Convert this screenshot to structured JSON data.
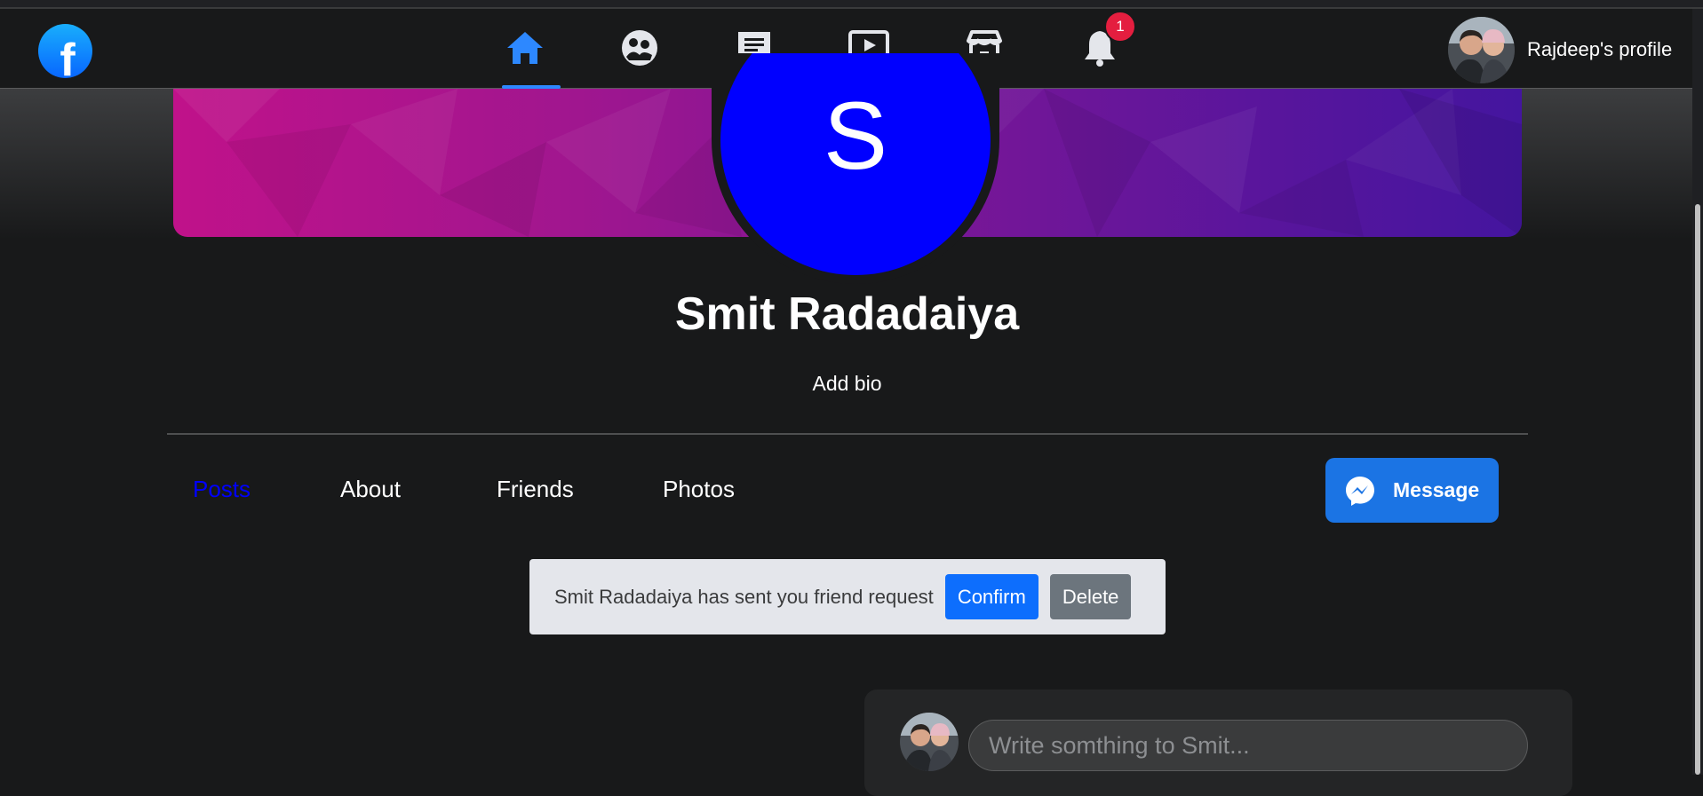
{
  "navbar": {
    "logo_letter": "f",
    "notification_count": "1",
    "profile_link": "Rajdeep's profile",
    "icons": [
      "home-icon",
      "groups-icon",
      "messages-icon",
      "watch-icon",
      "marketplace-icon",
      "bell-icon"
    ],
    "active_icon": "home-icon"
  },
  "profile": {
    "avatar_letter": "S",
    "name": "Smit Radadaiya",
    "bio": "Add bio"
  },
  "tabs": [
    "Posts",
    "About",
    "Friends",
    "Photos"
  ],
  "active_tab": "Posts",
  "message_button": "Message",
  "friend_request": {
    "text": "Smit Radadaiya has sent you friend request",
    "confirm": "Confirm",
    "delete": "Delete"
  },
  "composer": {
    "placeholder": "Write somthing to Smit..."
  },
  "colors": {
    "accent": "#2d88ff",
    "avatar_bg": "#0000ff",
    "active_tab": "#0000ff",
    "message_button": "#1b74e4",
    "confirm": "#0d6efd",
    "delete": "#6c757d"
  }
}
